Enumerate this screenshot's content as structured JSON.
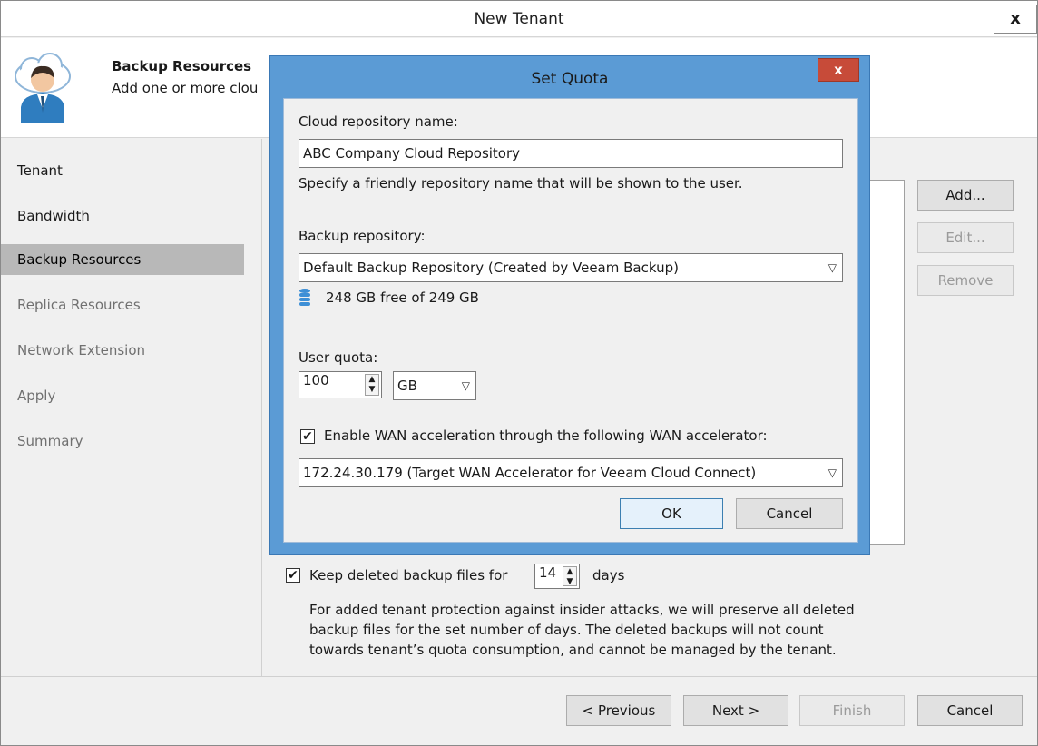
{
  "window": {
    "title": "New Tenant",
    "close_label": "x"
  },
  "header": {
    "title": "Backup Resources",
    "description": "Add one or more clou"
  },
  "sidebar": {
    "items": [
      {
        "label": "Tenant",
        "state": "done"
      },
      {
        "label": "Bandwidth",
        "state": "done"
      },
      {
        "label": "Backup Resources",
        "state": "active"
      },
      {
        "label": "Replica Resources",
        "state": "pending"
      },
      {
        "label": "Network Extension",
        "state": "pending"
      },
      {
        "label": "Apply",
        "state": "pending"
      },
      {
        "label": "Summary",
        "state": "pending"
      }
    ]
  },
  "side_buttons": {
    "add": "Add...",
    "edit": "Edit...",
    "remove": "Remove"
  },
  "keep_deleted": {
    "checked": true,
    "label_before": "Keep deleted backup files for",
    "value": "14",
    "label_after": "days",
    "description_lines": [
      "For added tenant protection against insider attacks, we will preserve all deleted",
      "backup files for the set number of days. The deleted backups will not count",
      "towards tenant’s quota consumption, and cannot be managed by the tenant."
    ]
  },
  "footer": {
    "previous": "< Previous",
    "next": "Next >",
    "finish": "Finish",
    "cancel": "Cancel"
  },
  "dialog": {
    "title": "Set Quota",
    "close_label": "x",
    "repo_name_label": "Cloud repository name:",
    "repo_name_value": "ABC Company Cloud Repository",
    "repo_name_hint": "Specify a friendly repository name that will be shown to the user.",
    "backup_repo_label": "Backup repository:",
    "backup_repo_value": "Default Backup Repository (Created by Veeam Backup)",
    "free_space": "248 GB free of 249 GB",
    "user_quota_label": "User quota:",
    "user_quota_value": "100",
    "user_quota_unit": "GB",
    "wan_checked": true,
    "wan_label": "Enable WAN acceleration through the following WAN accelerator:",
    "wan_value": "172.24.30.179 (Target WAN Accelerator for Veeam Cloud Connect)",
    "ok": "OK",
    "cancel": "Cancel"
  },
  "icons": {
    "avatar": "cloud-user-icon",
    "database": "database-icon",
    "chevron": "chevron-down-icon",
    "checkmark": "checkmark-icon"
  },
  "colors": {
    "dialog_frame": "#5b9bd5",
    "dialog_close": "#c74b39",
    "active_step": "#b8b8b8",
    "database_icon": "#3d8fd6"
  }
}
